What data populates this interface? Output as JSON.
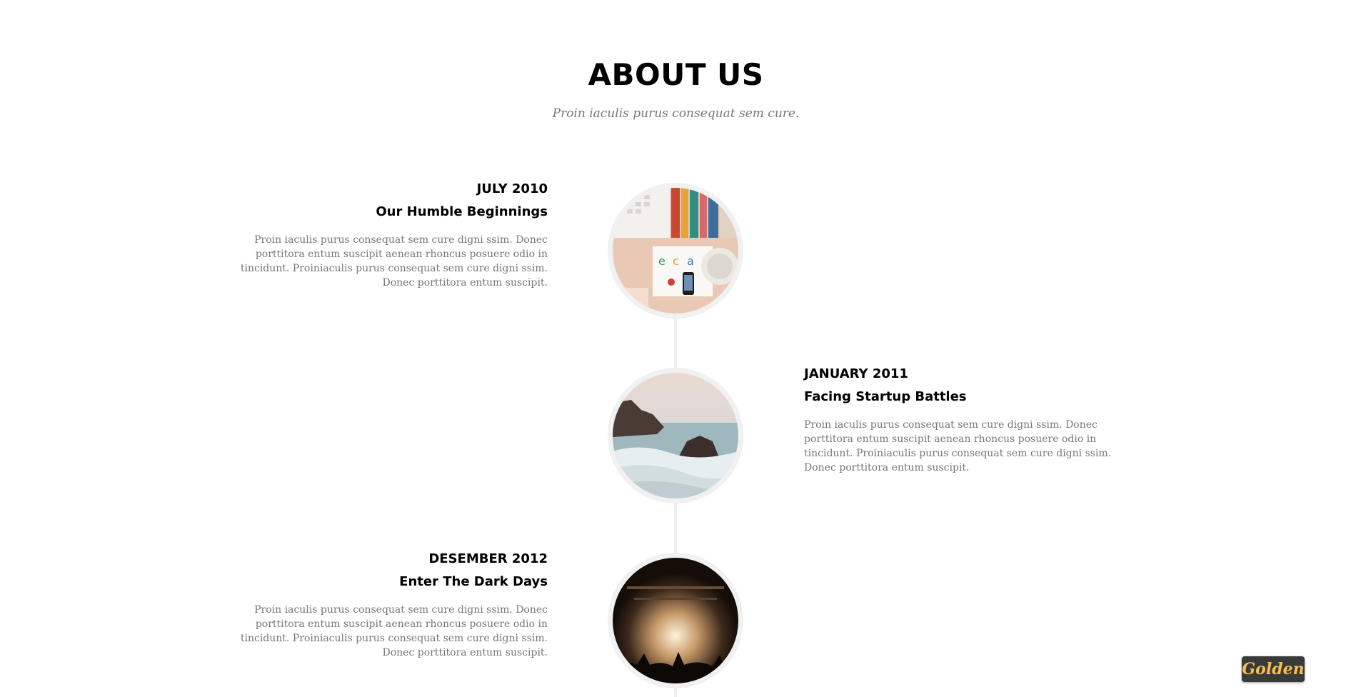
{
  "section": {
    "title": "ABOUT US",
    "subtitle": "Proin iaculis purus consequat sem cure."
  },
  "timeline": [
    {
      "date": "JULY 2010",
      "heading": "Our Humble Beginnings",
      "body": "Proin iaculis purus consequat sem cure digni ssim. Donec porttitora entum suscipit aenean rhoncus posuere odio in tincidunt. Proiniaculis purus consequat sem cure digni ssim. Donec porttitora entum suscipit.",
      "side": "left",
      "image": "desk-workspace-image"
    },
    {
      "date": "JANUARY 2011",
      "heading": "Facing Startup Battles",
      "body": "Proin iaculis purus consequat sem cure digni ssim. Donec porttitora entum suscipit aenean rhoncus posuere odio in tincidunt. Proiniaculis purus consequat sem cure digni ssim. Donec porttitora entum suscipit.",
      "side": "right",
      "image": "sea-rocks-image"
    },
    {
      "date": "DESEMBER 2012",
      "heading": "Enter The Dark Days",
      "body": "Proin iaculis purus consequat sem cure digni ssim. Donec porttitora entum suscipit aenean rhoncus posuere odio in tincidunt. Proiniaculis purus consequat sem cure digni ssim. Donec porttitora entum suscipit.",
      "side": "left",
      "image": "concert-crowd-image"
    }
  ],
  "badge": {
    "label": "Golden"
  },
  "colors": {
    "text": "#000000",
    "muted": "#777777",
    "line": "#eeeeee",
    "circle_border": "#f1f1f1",
    "badge_bg": "#3a3a3a",
    "badge_text": "#f2c14e"
  }
}
